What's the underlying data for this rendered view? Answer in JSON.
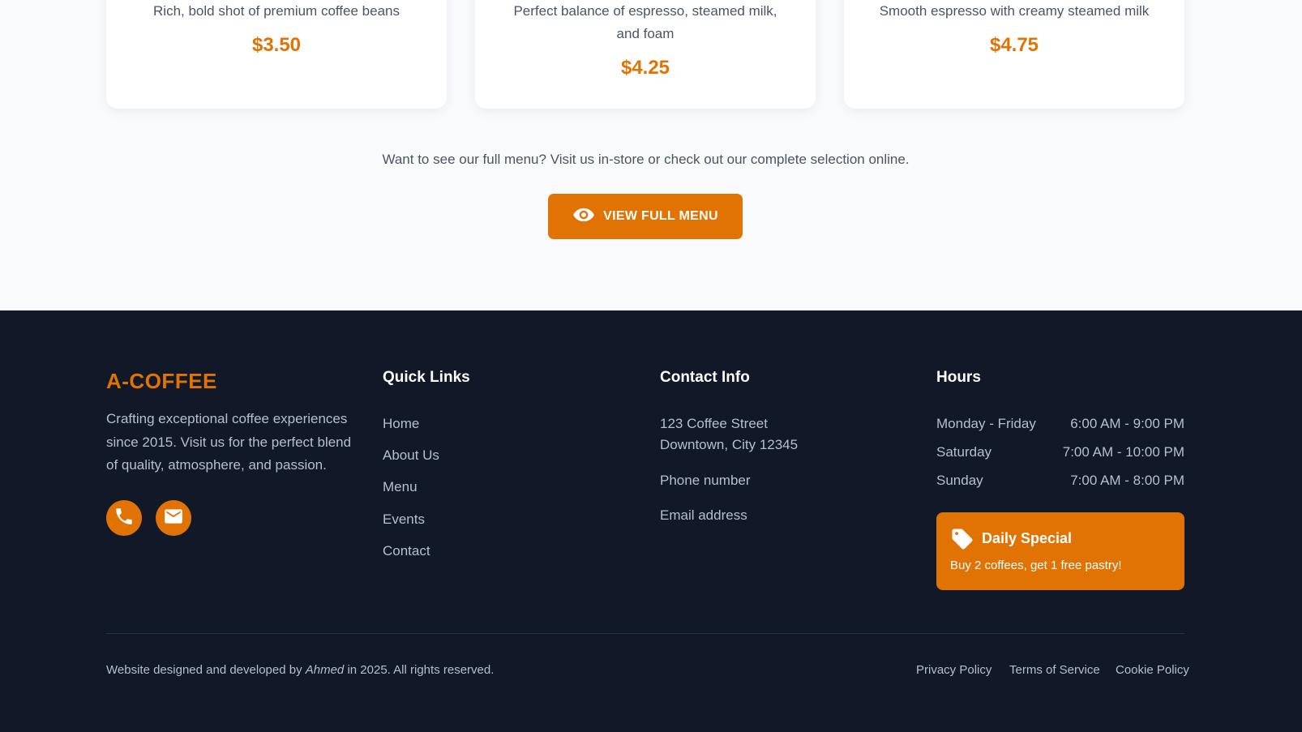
{
  "menu_cards": [
    {
      "description": "Rich, bold shot of premium coffee beans",
      "price": "$3.50"
    },
    {
      "description": "Perfect balance of espresso, steamed milk, and foam",
      "price": "$4.25"
    },
    {
      "description": "Smooth espresso with creamy steamed milk",
      "price": "$4.75"
    }
  ],
  "menu_note": "Want to see our full menu? Visit us in-store or check out our complete selection online.",
  "view_menu_button": {
    "label": "VIEW FULL MENU",
    "icon": "eye-icon"
  },
  "footer": {
    "brand": "A-COFFEE",
    "about": "Crafting exceptional coffee experiences since 2015. Visit us for the perfect blend of quality, atmosphere, and passion.",
    "social": [
      {
        "icon": "phone-icon"
      },
      {
        "icon": "mail-icon"
      }
    ],
    "quick_links": {
      "title": "Quick Links",
      "items": [
        "Home",
        "About Us",
        "Menu",
        "Events",
        "Contact"
      ]
    },
    "contact": {
      "title": "Contact Info",
      "address_line1": "123 Coffee Street",
      "address_line2": "Downtown, City 12345",
      "phone": "Phone number",
      "email": "Email address"
    },
    "hours": {
      "title": "Hours",
      "rows": [
        {
          "day": "Monday - Friday",
          "time": "6:00 AM - 9:00 PM"
        },
        {
          "day": "Saturday",
          "time": "7:00 AM - 10:00 PM"
        },
        {
          "day": "Sunday",
          "time": "7:00 AM - 8:00 PM"
        }
      ]
    },
    "special": {
      "title": "Daily Special",
      "description": "Buy 2 coffees, get 1 free pastry!",
      "icon": "tag-icon"
    },
    "copyright_prefix": "Website designed and developed by",
    "copyright_author": "Ahmed",
    "copyright_suffix": "in 2025. All rights reserved.",
    "legal_links": [
      "Privacy Policy",
      "Terms of Service",
      "Cookie Policy"
    ]
  },
  "colors": {
    "accent": "#e07304",
    "footer_bg": "#111827",
    "page_bg": "#f8fafc"
  }
}
